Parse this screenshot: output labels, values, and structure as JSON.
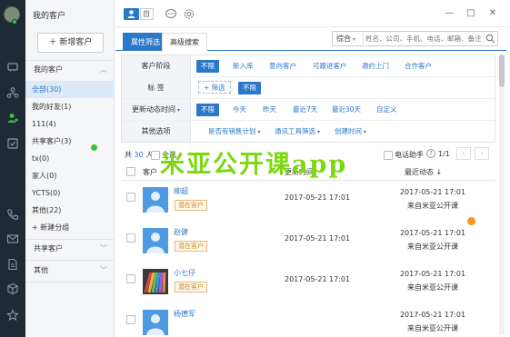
{
  "sidebar": {
    "title": "我的客户",
    "new_customer": "新增客户",
    "my_customers": "我的客户",
    "items": [
      {
        "label": "全部(30)"
      },
      {
        "label": "我的好友(1)"
      },
      {
        "label": "111(4)"
      },
      {
        "label": "共享客户(3)"
      },
      {
        "label": "tx(0)"
      },
      {
        "label": "家人(0)"
      },
      {
        "label": "YCTS(0)"
      },
      {
        "label": "其他(22)"
      }
    ],
    "new_group": "+ 新建分组",
    "shared": "共享客户",
    "other": "其他"
  },
  "topbar": {
    "min": "—",
    "max": "□",
    "close": "✕"
  },
  "tabs": {
    "filter": "属性筛选",
    "advanced": "高级搜索"
  },
  "search": {
    "scope": "综合",
    "placeholder": "姓名、公司、手机、电话、邮箱、备注"
  },
  "filters": {
    "stage": {
      "label": "客户阶段",
      "options": [
        "不限",
        "新入库",
        "意向客户",
        "可跟进客户",
        "邀约上门",
        "合作客户"
      ]
    },
    "tag": {
      "label": "标  签",
      "options": [
        "+ 筛选",
        "不限"
      ]
    },
    "update": {
      "label": "更新动态时间",
      "options": [
        "不限",
        "今天",
        "昨天",
        "最近7天",
        "最近30天",
        "自定义"
      ]
    },
    "other": {
      "label": "其他选项",
      "options": [
        "是否有销售计划",
        "通讯工具筛选",
        "创建时间"
      ]
    }
  },
  "toolbar": {
    "total_prefix": "共",
    "total_count": "30",
    "total_suffix": "人",
    "select_all": "全选",
    "phone_helper": "电话助手",
    "page": "1/1"
  },
  "table": {
    "col_customer": "客户",
    "col_update": "更新时间",
    "col_last": "最近动态 ↓"
  },
  "rows": [
    {
      "name": "柳超",
      "tag": "潜在客户",
      "updated": "2017-05-21 17:01",
      "last": "2017-05-21 17:01",
      "source": "来自米亚公开课"
    },
    {
      "name": "赵健",
      "tag": "潜在客户",
      "updated": "2017-05-21 17:01",
      "last": "2017-05-21 17:01",
      "source": "来自米亚公开课"
    },
    {
      "name": "小七仔",
      "tag": "潜在客户",
      "updated": "2017-05-21 17:01",
      "last": "2017-05-21 17:01",
      "source": "来自米亚公开课"
    },
    {
      "name": "杨德军",
      "tag": "",
      "updated": "",
      "last": "2017-05-21 17:01",
      "source": "来自米亚公开课"
    }
  ],
  "watermark": "米亚公开课app",
  "colors": {
    "accent": "#2b77c9",
    "rail": "#1e2a35",
    "watermark": "#7cd80f",
    "orange_dot": "#f7941d",
    "green_dot": "#3fbf3f"
  }
}
